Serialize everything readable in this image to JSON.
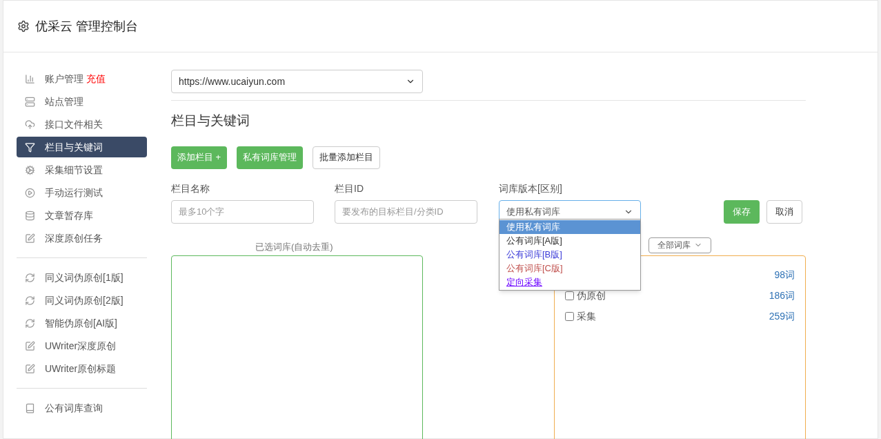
{
  "header": {
    "title": "优采云 管理控制台"
  },
  "sidebar": {
    "groups": [
      [
        {
          "label": "账户管理",
          "badge": "充值",
          "kind": "chart",
          "selected": false
        },
        {
          "label": "站点管理",
          "kind": "server",
          "selected": false
        },
        {
          "label": "接口文件相关",
          "kind": "cloud",
          "selected": false
        },
        {
          "label": "栏目与关键词",
          "kind": "filter",
          "selected": true
        },
        {
          "label": "采集细节设置",
          "kind": "gears",
          "selected": false
        },
        {
          "label": "手动运行测试",
          "kind": "play",
          "selected": false
        },
        {
          "label": "文章暂存库",
          "kind": "database",
          "selected": false
        },
        {
          "label": "深度原创任务",
          "kind": "edit",
          "selected": false
        }
      ],
      [
        {
          "label": "同义词伪原创[1版]",
          "kind": "refresh",
          "selected": false
        },
        {
          "label": "同义词伪原创[2版]",
          "kind": "refresh",
          "selected": false
        },
        {
          "label": "智能伪原创[AI版]",
          "kind": "refresh",
          "selected": false
        },
        {
          "label": "UWriter深度原创",
          "kind": "edit",
          "selected": false
        },
        {
          "label": "UWriter原创标题",
          "kind": "edit",
          "selected": false
        }
      ],
      [
        {
          "label": "公有词库查询",
          "kind": "book",
          "selected": false
        }
      ]
    ]
  },
  "site_select": {
    "value": "https://www.ucaiyun.com"
  },
  "section_title": "栏目与关键词",
  "actions": [
    {
      "label": "添加栏目 +",
      "kind": "primary"
    },
    {
      "label": "私有词库管理",
      "kind": "primary"
    },
    {
      "label": "批量添加栏目",
      "kind": "default"
    }
  ],
  "form": {
    "name": {
      "label": "栏目名称",
      "placeholder": "最多10个字"
    },
    "id": {
      "label": "栏目ID",
      "placeholder": "要发布的目标栏目/分类ID"
    },
    "version": {
      "label": "词库版本[区别]",
      "value": "使用私有词库",
      "expanded": true,
      "options": [
        {
          "label": "使用私有词库",
          "selected": true
        },
        {
          "label": "公有词库[A版]",
          "selected": false,
          "color": "#333333"
        },
        {
          "label": "公有词库[B版]",
          "selected": false,
          "color": "#3b3bd8"
        },
        {
          "label": "公有词库[C版]",
          "selected": false,
          "color": "#c0504d"
        },
        {
          "label": "定向采集",
          "selected": false,
          "color": "#6a00ff"
        }
      ]
    },
    "save": "保存",
    "cancel": "取消"
  },
  "selected_label": "已选词库(自动去重)",
  "filter_select": {
    "value": "全部词库"
  },
  "library": [
    {
      "count": "98词"
    },
    {
      "name": "伪原创",
      "count": "186词",
      "checked": false
    },
    {
      "name": "采集",
      "count": "259词",
      "checked": false
    }
  ]
}
